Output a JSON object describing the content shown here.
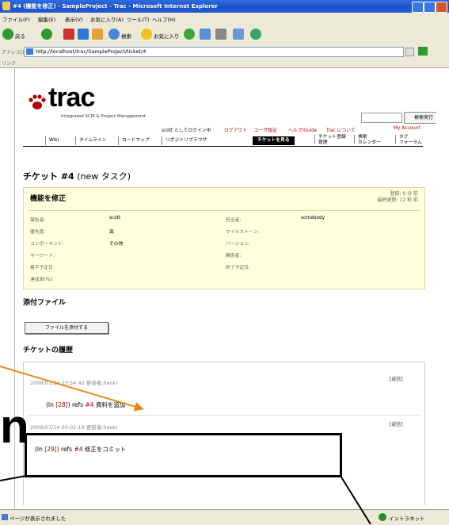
{
  "window": {
    "title": "#4 (機能を修正) - SampleProject - Trac - Microsoft Internet Explorer"
  },
  "menu": [
    "ファイル(F)",
    "編集(E)",
    "表示(V)",
    "お気に入り(A)",
    "ツール(T)",
    "ヘルプ(H)"
  ],
  "toolbar": {
    "back": "戻る",
    "search": "検索",
    "favorites": "お気に入り"
  },
  "address": {
    "label": "アドレス(D)",
    "url": "http://localhost/trac/SampleProject/ticket/4"
  },
  "links": {
    "label": "リンク"
  },
  "trac": {
    "logo": "trac",
    "subtitle": "Integrated SCM & Project Management",
    "search_button": "検索実行",
    "metanav": [
      "scott としてログイン中",
      "ログアウト",
      "ユーザ設定",
      "ヘルプ/Guide",
      "Trac について",
      "My Account"
    ],
    "tabs": [
      "Wiki",
      "タイムライン",
      "ロードマップ",
      "リポジトリブラウザ",
      "チケットを見る",
      "チケット登録",
      "検索",
      "タグ",
      "フォーラム"
    ],
    "tabs_second": {
      "ticket_new": "管理",
      "search": "カレンダー",
      "tags": "フォーラム"
    }
  },
  "ticket": {
    "heading_prefix": "チケット ",
    "heading_num": "#4",
    "heading_suffix": " (new タスク)",
    "summary": "機能を修正",
    "opened": "登録: 9 分 前",
    "modified": "最終更新: 12 秒 前",
    "fields": {
      "reporter_label": "報告者:",
      "reporter": "scott",
      "owner_label": "担当者:",
      "owner": "somebody",
      "priority_label": "優先度:",
      "priority": "高",
      "milestone_label": "マイルストーン:",
      "milestone": "",
      "component_label": "コンポーネント:",
      "component": "その他",
      "version_label": "バージョン:",
      "version": "",
      "keywords_label": "キーワード:",
      "keywords": "",
      "cc_label": "関係者:",
      "cc": "",
      "start_label": "着手予定日:",
      "start": "",
      "due_label": "終了予定日:",
      "due": "",
      "progress_label": "達成率(%):",
      "progress": ""
    }
  },
  "attachments": {
    "heading": "添付ファイル",
    "button": "ファイルを添付する"
  },
  "history": {
    "heading": "チケットの履歴",
    "changes": [
      {
        "date": "2008/07/13 23:54:42",
        "author_label": "更新者:",
        "author": "heoki",
        "reply": "返信",
        "text_pre": "(In ",
        "link": "[28]",
        "text_mid": ") refs ",
        "ticket": "#4",
        "text_post": " 資料を追加"
      },
      {
        "date": "2008/07/14 00:02:19",
        "author_label": "更新者:",
        "author": "heoki",
        "reply": "返信",
        "text_pre": "(In ",
        "link": "[29]",
        "text_mid": ") refs ",
        "ticket": "#4",
        "text_post": " 修正をコミット"
      }
    ]
  },
  "status": {
    "left": "ページが表示されました",
    "zone": "イントラネット"
  },
  "annotation": {
    "letter": "n"
  },
  "colors": {
    "title_bar": "#1a4fc4",
    "trac_red": "#b00000",
    "ticket_bg": "#ffffdd",
    "arrow": "#e88a1a"
  }
}
